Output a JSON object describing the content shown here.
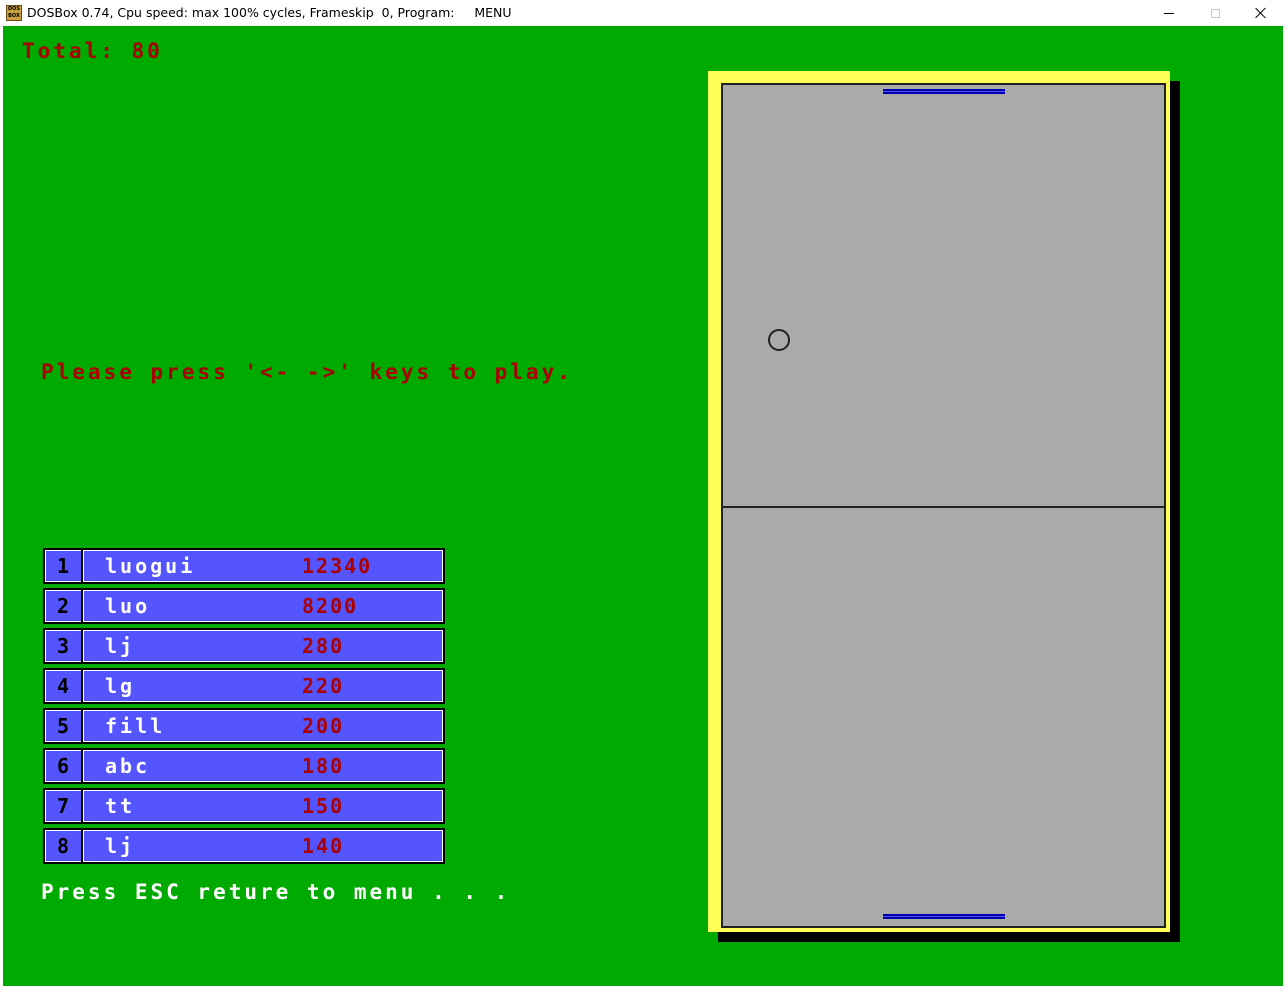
{
  "window": {
    "title": "DOSBox 0.74, Cpu speed: max 100% cycles, Frameskip  0, Program:     MENU",
    "icon_text": "DOS BOX",
    "controls": {
      "minimize": "minimize-icon",
      "maximize": "maximize-icon",
      "close": "close-icon"
    }
  },
  "game": {
    "total_label": "Total: 80",
    "instruction": "Please press '<- ->' keys to play.",
    "esc_hint": "Press ESC reture to menu . . .",
    "leaderboard": [
      {
        "rank": "1",
        "name": "luogui",
        "score": "12340"
      },
      {
        "rank": "2",
        "name": "luo",
        "score": "8200"
      },
      {
        "rank": "3",
        "name": "lj",
        "score": "280"
      },
      {
        "rank": "4",
        "name": "lg",
        "score": "220"
      },
      {
        "rank": "5",
        "name": "fill",
        "score": "200"
      },
      {
        "rank": "6",
        "name": "abc",
        "score": "180"
      },
      {
        "rank": "7",
        "name": "tt",
        "score": "150"
      },
      {
        "rank": "8",
        "name": "lj",
        "score": "140"
      }
    ],
    "colors": {
      "background": "#00aa00",
      "red_text": "#aa0000",
      "row_fill": "#5555ff",
      "court": "#aaaaaa",
      "frame": "#ffff55",
      "paddle": "#0000aa"
    }
  }
}
